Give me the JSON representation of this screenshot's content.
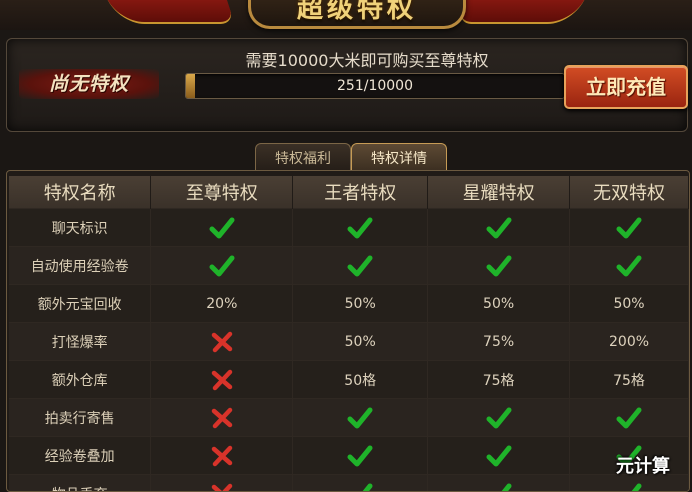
{
  "title": "超级特权",
  "header": {
    "status_label": "尚无特权",
    "requirement_text": "需要10000大米即可购买至尊特权",
    "progress_text": "251/10000",
    "progress_fraction": 0.0251,
    "recharge_label": "立即充值"
  },
  "tabs": [
    {
      "label": "特权福利",
      "active": false
    },
    {
      "label": "特权详情",
      "active": true
    }
  ],
  "table": {
    "columns": [
      "特权名称",
      "至尊特权",
      "王者特权",
      "星耀特权",
      "无双特权"
    ],
    "rows": [
      {
        "name": "聊天标识",
        "values": [
          "check",
          "check",
          "check",
          "check"
        ]
      },
      {
        "name": "自动使用经验卷",
        "values": [
          "check",
          "check",
          "check",
          "check"
        ]
      },
      {
        "name": "额外元宝回收",
        "values": [
          "20%",
          "50%",
          "50%",
          "50%"
        ]
      },
      {
        "name": "打怪爆率",
        "values": [
          "cross",
          "50%",
          "75%",
          "200%"
        ]
      },
      {
        "name": "额外仓库",
        "values": [
          "cross",
          "50格",
          "75格",
          "75格"
        ]
      },
      {
        "name": "拍卖行寄售",
        "values": [
          "cross",
          "check",
          "check",
          "check"
        ]
      },
      {
        "name": "经验卷叠加",
        "values": [
          "cross",
          "check",
          "check",
          "check"
        ]
      },
      {
        "name": "物品丢弃",
        "values": [
          "cross",
          "check",
          "check",
          "check"
        ]
      }
    ]
  },
  "colors": {
    "check": "#1fb32a",
    "cross": "#d8332a",
    "accent_gold": "#c69b55"
  },
  "watermark": "元计算"
}
